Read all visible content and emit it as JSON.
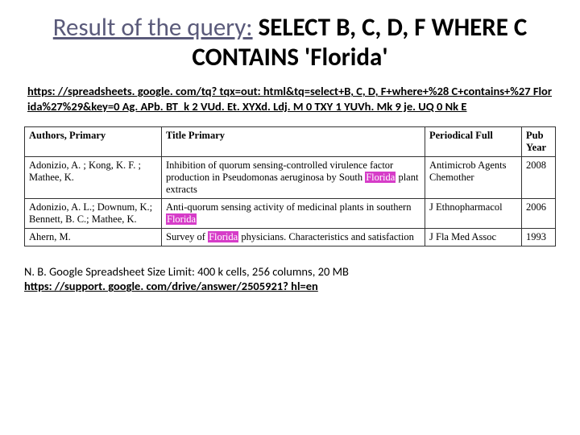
{
  "title": {
    "prefix": "Result of the query:",
    "query": "SELECT B, C, D, F WHERE C CONTAINS 'Florida'"
  },
  "query_url": "https: //spreadsheets. google. com/tq? tqx=out: html&tq=select+B, C, D, F+where+%28 C+contains+%27 Florida%27%29&key=0 Ag. APb. BT_k 2 VUd. Et. XYXd. Ldj. M 0 TXY 1 YUVh. Mk 9 je. UQ 0 Nk E",
  "table": {
    "headers": [
      "Authors, Primary",
      "Title Primary",
      "Periodical Full",
      "Pub Year"
    ],
    "rows": [
      {
        "authors": "Adonizio, A. ; Kong, K. F. ; Mathee, K.",
        "title_pre": "Inhibition of quorum sensing-controlled virulence factor production in Pseudomonas aeruginosa by South ",
        "title_hl": "Florida",
        "title_post": " plant extracts",
        "periodical": "Antimicrob Agents Chemother",
        "year": "2008"
      },
      {
        "authors": "Adonizio, A. L.; Downum, K.; Bennett, B. C.; Mathee, K.",
        "title_pre": "Anti-quorum sensing activity of medicinal plants in southern ",
        "title_hl": "Florida",
        "title_post": "",
        "periodical": "J Ethnopharmacol",
        "year": "2006"
      },
      {
        "authors": "Ahern, M.",
        "title_pre": "Survey of ",
        "title_hl": "Florida",
        "title_post": " physicians. Characteristics and satisfaction",
        "periodical": "J Fla Med Assoc",
        "year": "1993"
      }
    ]
  },
  "nb": {
    "text": "N. B. Google Spreadsheet Size Limit: 400 k cells, 256 columns, 20 MB",
    "link": "https: //support. google. com/drive/answer/2505921? hl=en"
  },
  "chart_data": {
    "type": "table",
    "title": "Result of the query: SELECT B, C, D, F WHERE C CONTAINS 'Florida'",
    "columns": [
      "Authors, Primary",
      "Title Primary",
      "Periodical Full",
      "Pub Year"
    ],
    "rows": [
      [
        "Adonizio, A. ; Kong, K. F. ; Mathee, K.",
        "Inhibition of quorum sensing-controlled virulence factor production in Pseudomonas aeruginosa by South Florida plant extracts",
        "Antimicrob Agents Chemother",
        2008
      ],
      [
        "Adonizio, A. L.; Downum, K.; Bennett, B. C.; Mathee, K.",
        "Anti-quorum sensing activity of medicinal plants in southern Florida",
        "J Ethnopharmacol",
        2006
      ],
      [
        "Ahern, M.",
        "Survey of Florida physicians. Characteristics and satisfaction",
        "J Fla Med Assoc",
        1993
      ]
    ]
  }
}
